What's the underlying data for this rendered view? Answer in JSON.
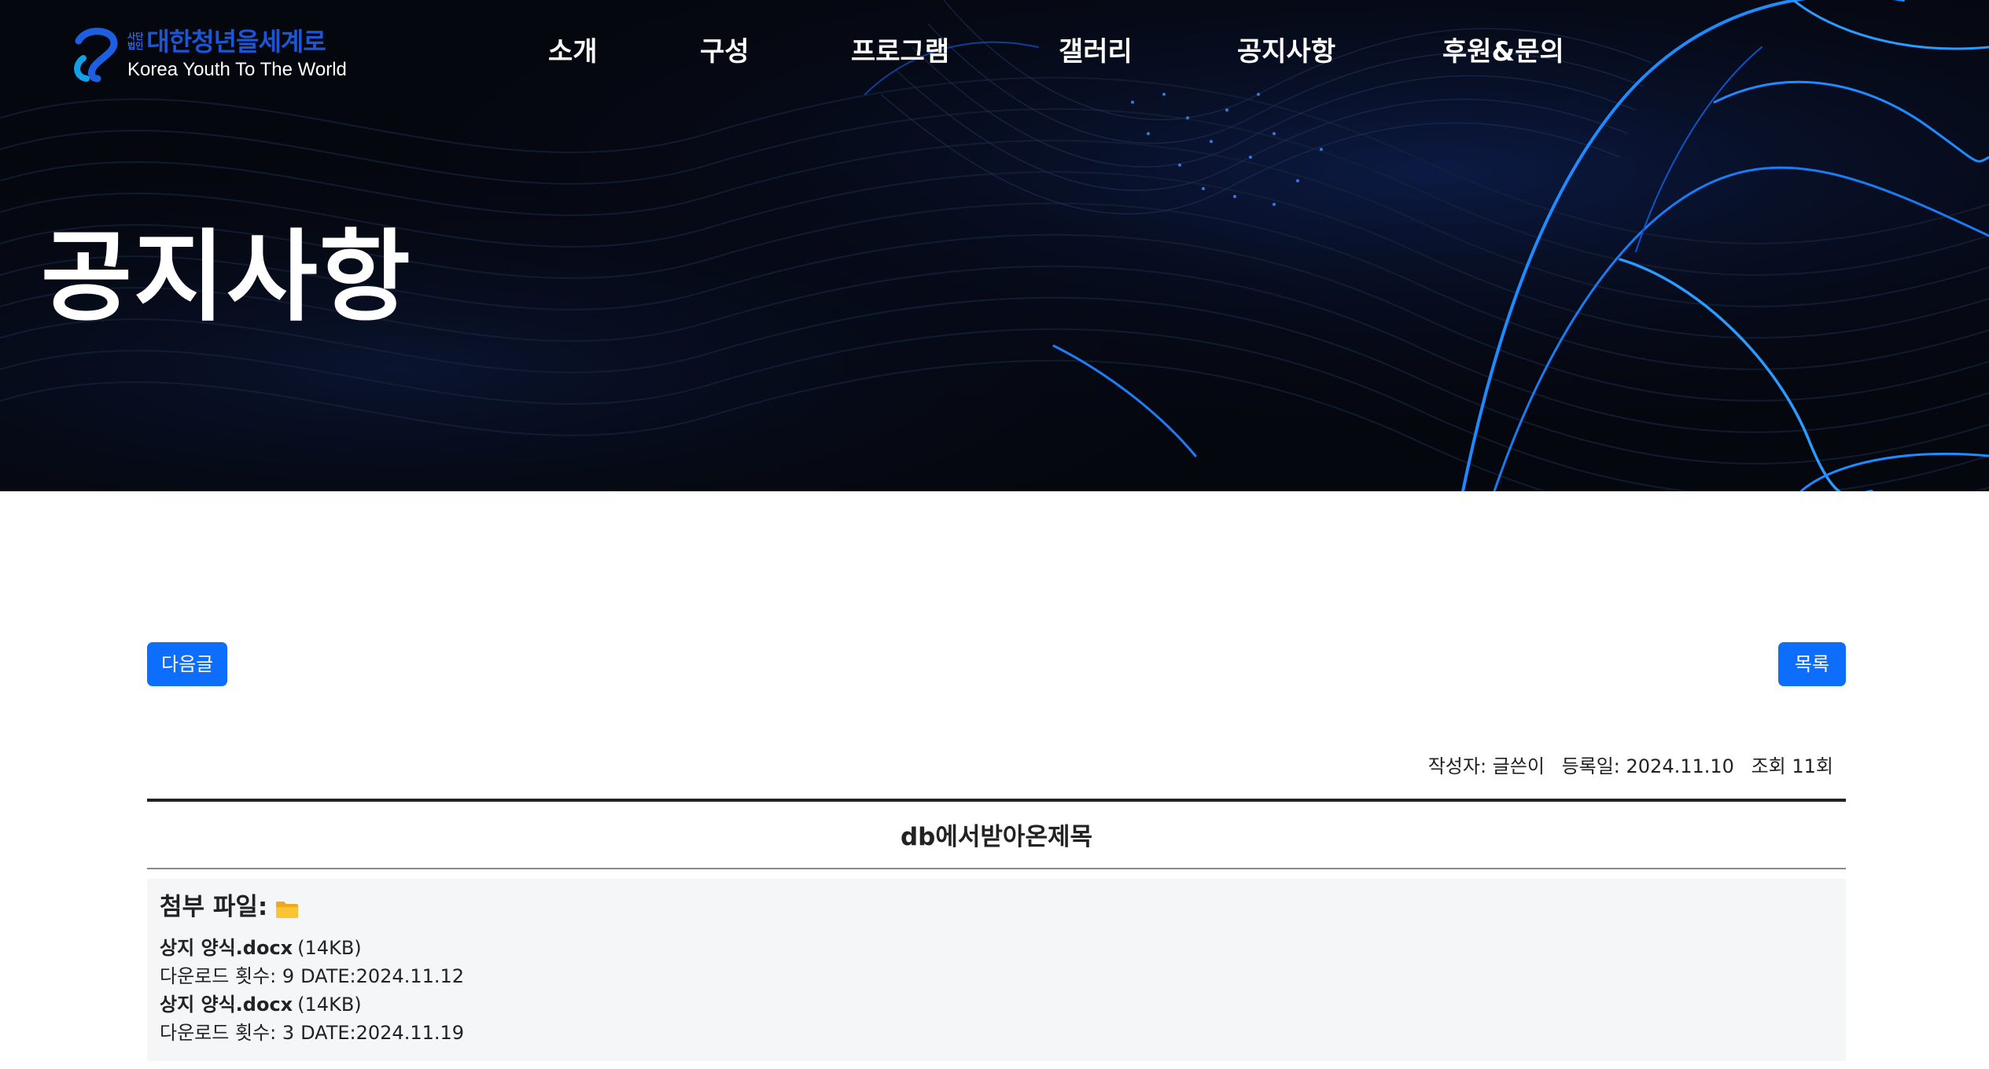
{
  "header": {
    "logo": {
      "corp_label_top": "사단",
      "corp_label_bottom": "법인",
      "name_ko": "대한청년을세계로",
      "name_en": "Korea Youth To The World"
    },
    "nav": [
      {
        "label": "소개"
      },
      {
        "label": "구성"
      },
      {
        "label": "프로그램"
      },
      {
        "label": "갤러리"
      },
      {
        "label": "공지사항"
      },
      {
        "label": "후원&문의"
      }
    ]
  },
  "hero": {
    "title": "공지사항"
  },
  "post": {
    "next_button": "다음글",
    "list_button": "목록",
    "meta": {
      "author": "작성자: 글쓴이",
      "date": "등록일: 2024.11.10",
      "views": "조회 11회"
    },
    "title": "db에서받아온제목",
    "attachments": {
      "heading": "첨부 파일:",
      "files": [
        {
          "name": "상지 양식.docx",
          "size": "(14KB)",
          "downloads": "다운로드 횟수: 9",
          "date": "DATE:2024.11.12"
        },
        {
          "name": "상지 양식.docx",
          "size": "(14KB)",
          "downloads": "다운로드 횟수: 3",
          "date": "DATE:2024.11.19"
        }
      ]
    }
  },
  "colors": {
    "accent": "#0d6efd",
    "hero_bg": "#04060c",
    "logo_blue": "#1c56d6",
    "attach_bg": "#f5f6f8"
  },
  "icons": [
    "logo-mark-icon",
    "folder-icon"
  ]
}
